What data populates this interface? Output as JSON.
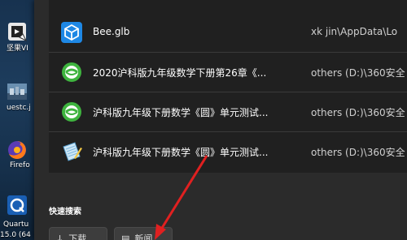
{
  "desktop": {
    "items": [
      {
        "label": "坚果VI",
        "icon": "app-shortcut-icon"
      },
      {
        "label": "uestc.j",
        "icon": "photo-file-icon"
      },
      {
        "label": "Firefo",
        "icon": "firefox-icon"
      },
      {
        "label": "Quartu",
        "icon": "quartus-icon"
      },
      {
        "label": "15.0 (64",
        "icon": ""
      }
    ]
  },
  "results": [
    {
      "name": "Bee.glb",
      "path": "xk jin\\AppData\\Lo",
      "icon": "3d-object-icon"
    },
    {
      "name": "2020沪科版九年级数学下册第26章《...",
      "path": "others (D:)\\360安全",
      "icon": "360-document-icon"
    },
    {
      "name": "沪科版九年级下册数学《圆》单元测试...",
      "path": "others (D:)\\360安全",
      "icon": "360-document-icon"
    },
    {
      "name": "沪科版九年级下册数学《圆》单元测试...",
      "path": "others (D:)\\360安全",
      "icon": "notepad-icon"
    }
  ],
  "quick_search": {
    "title": "快速搜索",
    "buttons": [
      {
        "label": "下载",
        "icon": "download-icon"
      },
      {
        "label": "新闻",
        "icon": "news-icon"
      }
    ]
  },
  "colors": {
    "panel": "#2b2b2b",
    "results_bg": "#202020",
    "accent_360": "#3fb43f",
    "arrow": "#e02020"
  }
}
